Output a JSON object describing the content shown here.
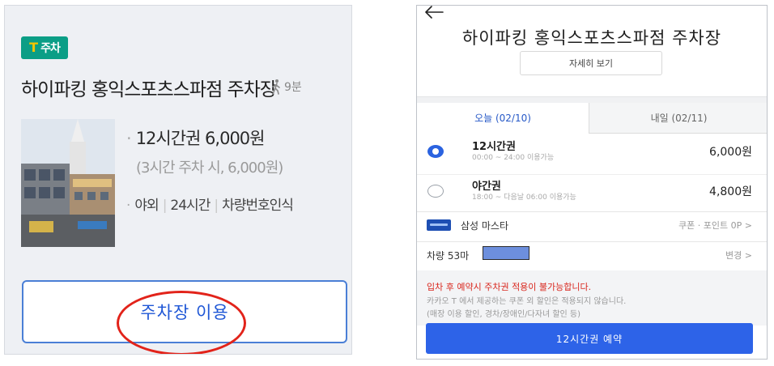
{
  "left": {
    "brand_mark": "T",
    "brand_text": "주차",
    "lot_name": "하이파킹 홍익스포츠스파점 주차장",
    "walk_time": "9분",
    "price_line": "12시간권 6,000원",
    "sub_price": "(3시간 주차 시, 6,000원)",
    "features": [
      "야외",
      "24시간",
      "차량번호인식"
    ],
    "use_button": "주차장 이용"
  },
  "right": {
    "title": "하이파킹 홍익스포츠스파점 주차장",
    "detail_button": "자세히 보기",
    "tabs": [
      {
        "label": "오늘 (02/10)",
        "active": true
      },
      {
        "label": "내일 (02/11)",
        "active": false
      }
    ],
    "tickets": [
      {
        "name": "12시간권",
        "time": "00:00 ~ 24:00 이용가능",
        "price": "6,000원",
        "selected": true
      },
      {
        "name": "야간권",
        "time": "18:00 ~ 다음날 06:00 이용가능",
        "price": "4,800원",
        "selected": false
      }
    ],
    "payment": {
      "card": "삼성 마스타",
      "right": "쿠폰 · 포인트 0P >"
    },
    "car": {
      "label": "차량 53마",
      "change": "변경 >"
    },
    "warning_red": "입차 후 예약시 주차권 적용이 불가능합니다.",
    "warning_gray_1": "카카오 T 에서 제공하는 쿠폰 외 할인은 적용되지 않습니다.",
    "warning_gray_2": "(매장 이용 할인, 경차/장애인/다자녀 할인 등)",
    "reserve_button": "12시간권 예약"
  },
  "colors": {
    "brand_green": "#0b9e86",
    "brand_yellow": "#f4c400",
    "primary_blue": "#2d63e8",
    "warning_red": "#d9271e",
    "highlight_ellipse": "#e2231a"
  }
}
